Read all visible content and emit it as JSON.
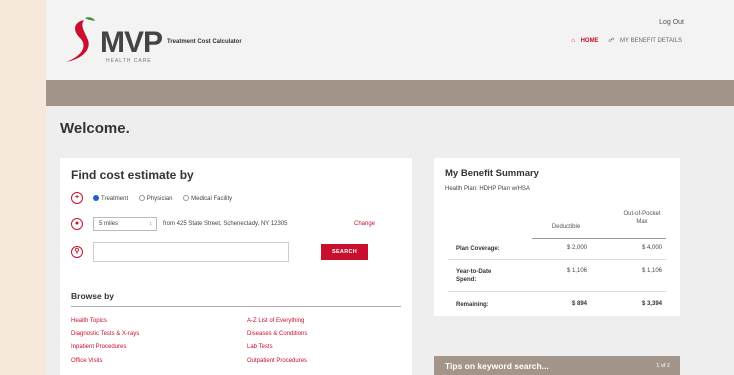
{
  "header": {
    "logo_text": "MVP",
    "logo_sub": "HEALTH CARE",
    "app_title": "Treatment Cost Calculator",
    "logout": "Log Out",
    "nav": [
      {
        "label": "HOME",
        "icon": "house-icon"
      },
      {
        "label": "MY BENEFIT DETAILS",
        "icon": "link-icon"
      }
    ]
  },
  "welcome": "Welcome.",
  "find": {
    "title": "Find cost estimate by",
    "options": [
      "Treatment",
      "Physician",
      "Medical Facility"
    ],
    "selected": "Treatment",
    "distance": "5 miles",
    "distance_caret": "↕",
    "from_address": "from 425 State Street, Schenectady, NY 12305",
    "change_label": "Change",
    "search_placeholder": "",
    "search_button": "SEARCH",
    "icons": [
      "plus-icon",
      "location-pin-icon",
      "search-icon"
    ]
  },
  "browse": {
    "title": "Browse by",
    "left": [
      "Health Topics",
      "Diagnostic Tests & X-rays",
      "Inpatient Procedures",
      "Office Visits"
    ],
    "right": [
      "A-Z List of Everything",
      "Diseases & Conditions",
      "Lab Tests",
      "Outpatient Procedures"
    ]
  },
  "benefit": {
    "title": "My Benefit Summary",
    "plan": "Health Plan: HDHP Plan w/HSA",
    "col_deductible": "Deductible",
    "col_oop_line1": "Out-of-Pocket",
    "col_oop_line2": "Max",
    "rows": [
      {
        "label_line1": "Plan Coverage:",
        "label_line2": "",
        "deductible": "$ 2,000",
        "oop": "$ 4,000"
      },
      {
        "label_line1": "Year-to-Date",
        "label_line2": "Spend:",
        "deductible": "$ 1,106",
        "oop": "$ 1,106"
      },
      {
        "label_line1": "Remaining:",
        "label_line2": "",
        "deductible": "$ 894",
        "oop": "$ 3,394"
      }
    ]
  },
  "tips": {
    "title": "Tips on keyword search...",
    "page": "1 of 2"
  },
  "colors": {
    "accent": "#c8102e",
    "band": "#a4958a",
    "radio_selected": "#1f63c6"
  }
}
